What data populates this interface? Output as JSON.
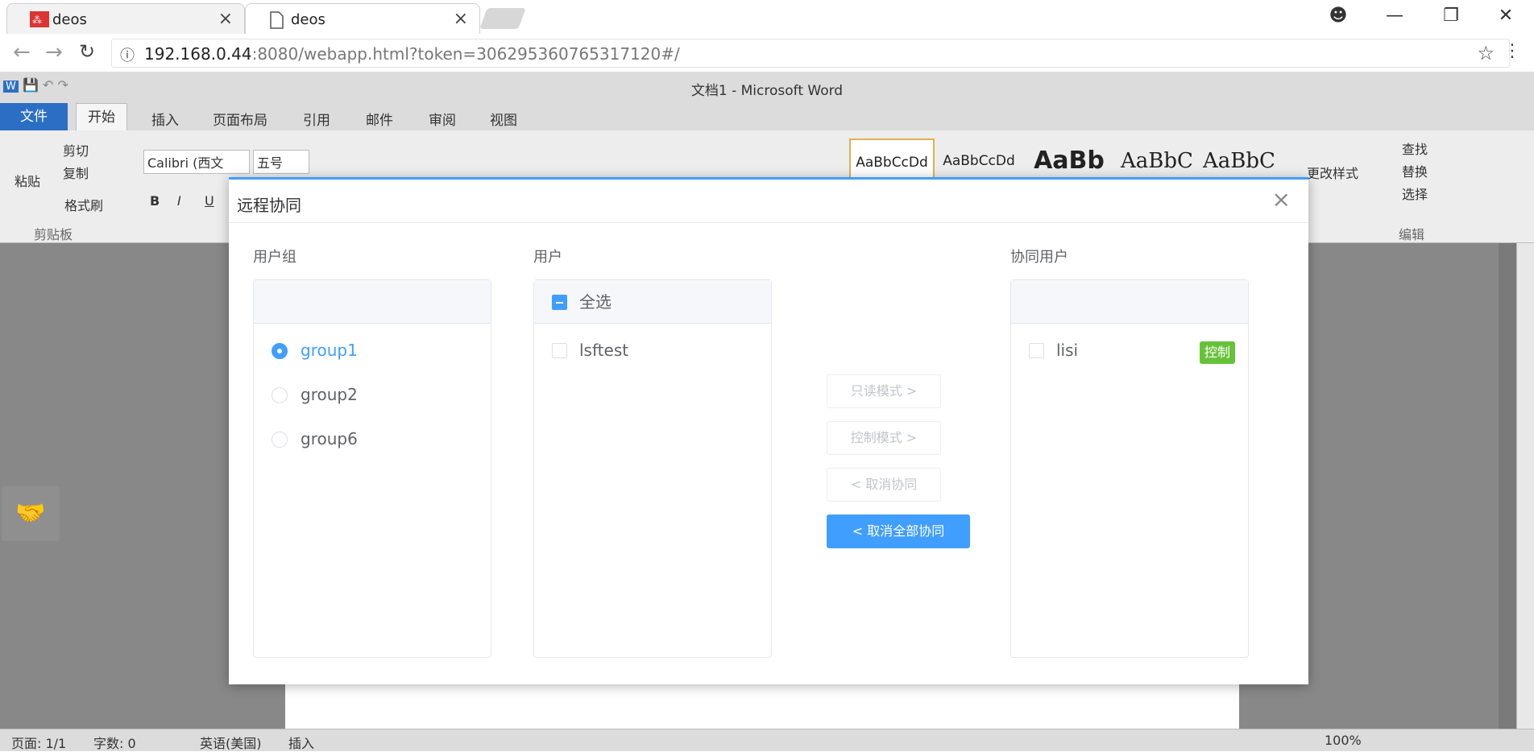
{
  "browser": {
    "tabs": [
      {
        "title": "deos",
        "active": false,
        "favicon": "deos-logo-icon"
      },
      {
        "title": "deos",
        "active": true,
        "favicon": "page-icon"
      }
    ],
    "close_glyph": "×",
    "address": {
      "host": "192.168.0.44",
      "rest": ":8080/webapp.html?token=306295360765317120#/"
    }
  },
  "word": {
    "title": "文档1 - Microsoft Word",
    "ribbon_tabs": [
      "文件",
      "开始",
      "插入",
      "页面布局",
      "引用",
      "邮件",
      "审阅",
      "视图"
    ],
    "clipboard": {
      "paste": "粘贴",
      "cut": "剪切",
      "copy": "复制",
      "format_painter": "格式刷",
      "group": "剪贴板"
    },
    "font": {
      "name": "Calibri (西文",
      "size": "五号"
    },
    "styles": [
      "AaBbCcDd",
      "AaBbCcDd",
      "AaBb",
      "AaBbC",
      "AaBbC"
    ],
    "change_styles": "更改样式",
    "editing": {
      "find": "查找",
      "replace": "替换",
      "select": "选择",
      "group": "编辑"
    },
    "status": {
      "page": "页面: 1/1",
      "words": "字数: 0",
      "lang": "英语(美国)",
      "mode": "插入",
      "zoom": "100%"
    }
  },
  "dialog": {
    "title": "远程协同",
    "groups_label": "用户组",
    "users_label": "用户",
    "collab_label": "协同用户",
    "groups": [
      {
        "name": "group1",
        "selected": true
      },
      {
        "name": "group2",
        "selected": false
      },
      {
        "name": "group6",
        "selected": false
      }
    ],
    "select_all": "全选",
    "users": [
      {
        "name": "lsftest",
        "checked": false
      }
    ],
    "buttons": {
      "readonly": "只读模式 >",
      "control": "控制模式 >",
      "cancel": "< 取消协同",
      "cancel_all": "< 取消全部协同"
    },
    "collab_users": [
      {
        "name": "lisi",
        "mode": "控制"
      }
    ],
    "colors": {
      "primary": "#409eff",
      "tag": "#67c23a"
    }
  }
}
